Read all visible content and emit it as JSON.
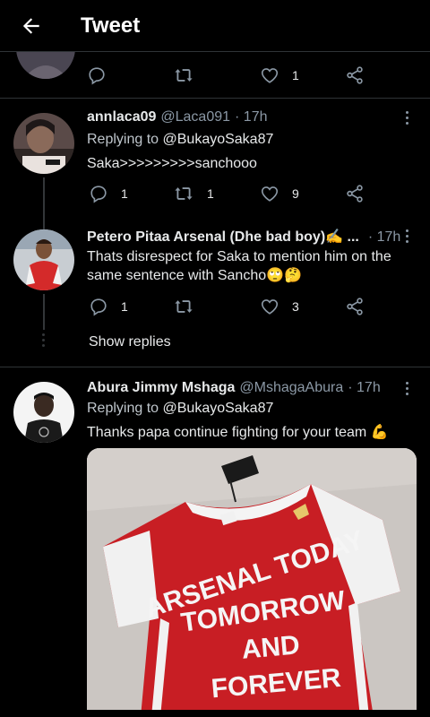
{
  "header": {
    "title": "Tweet"
  },
  "prev_tweet": {
    "like_count": "1"
  },
  "replies": [
    {
      "name": "annlaca09",
      "handle": "@Laca091",
      "time": "· 17h",
      "reply_prefix": "Replying to ",
      "reply_to": "@BukayoSaka87",
      "text": "Saka>>>>>>>>>sanchooo",
      "reply_count": "1",
      "retweet_count": "1",
      "like_count": "9"
    },
    {
      "name": "Petero Pitaa Arsenal (Dhe bad boy)✍️ ...",
      "time": "· 17h",
      "text": "Thats disrespect for Saka to mention him on the same sentence with Sancho🙄🤔",
      "reply_count": "1",
      "retweet_count": "",
      "like_count": "3"
    },
    {
      "name": "Abura Jimmy Mshaga",
      "handle": "@MshagaAbura",
      "time": "· 17h",
      "reply_prefix": "Replying to ",
      "reply_to": "@BukayoSaka87",
      "text": "Thanks papa continue fighting for your team 💪",
      "image_text": [
        "ARSENAL TODAY",
        "TOMORROW",
        "AND",
        "FOREVER"
      ]
    }
  ],
  "show_replies_label": "Show replies",
  "icons": [
    "back-arrow-icon",
    "reply-icon",
    "retweet-icon",
    "like-icon",
    "share-icon",
    "more-icon"
  ]
}
